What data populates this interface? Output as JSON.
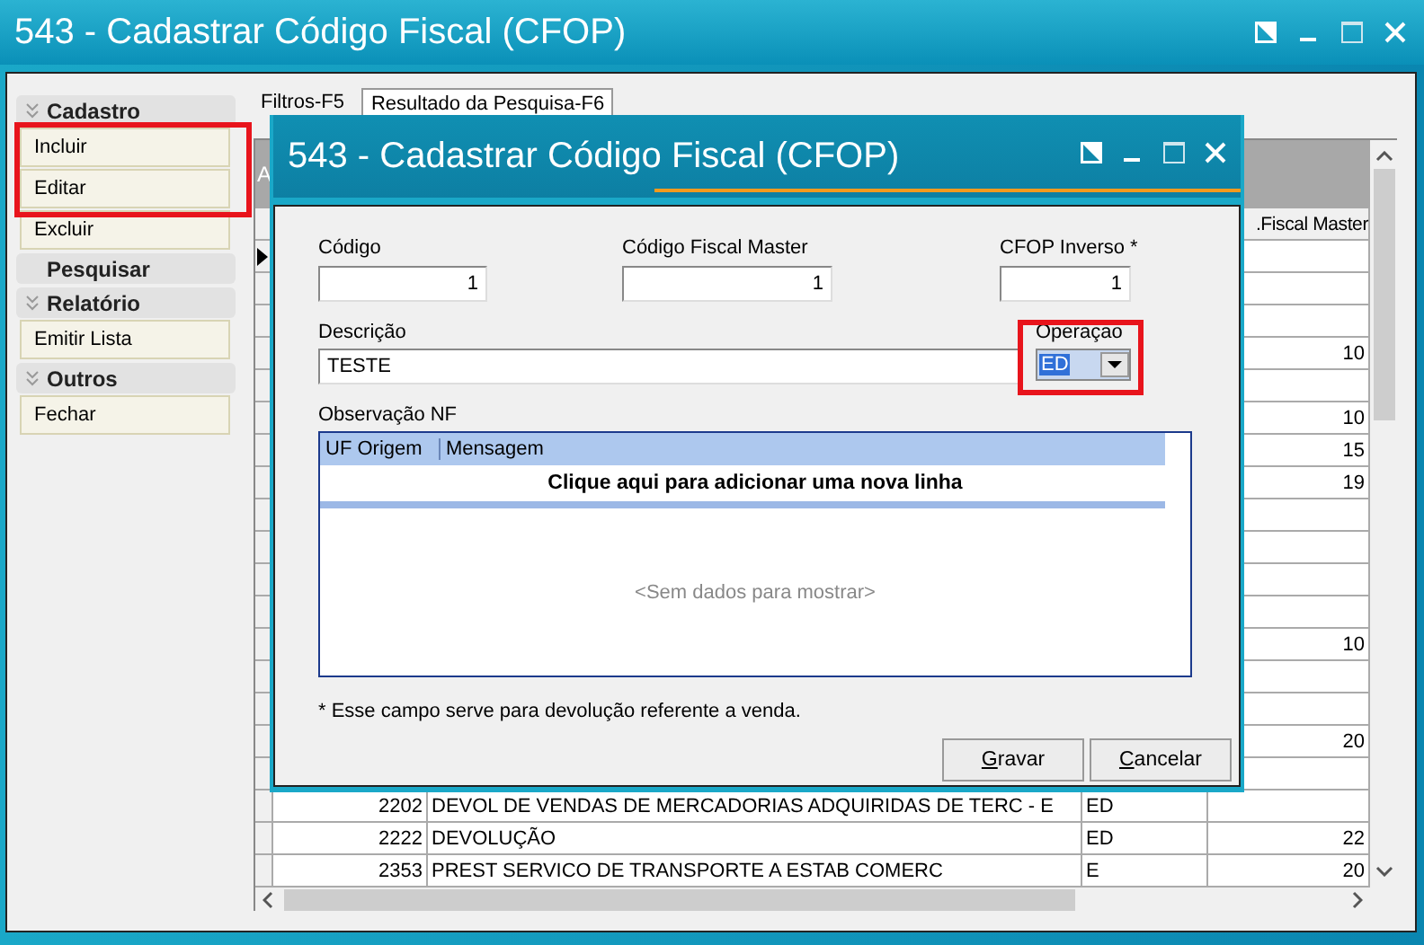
{
  "window": {
    "title": "543 - Cadastrar Código Fiscal (CFOP)"
  },
  "sidebar": {
    "groups": [
      {
        "title": "Cadastro",
        "collapsible": true,
        "items": [
          "Incluir",
          "Editar",
          "Excluir"
        ]
      },
      {
        "title": "Pesquisar",
        "collapsible": false
      },
      {
        "title": "Relatório",
        "collapsible": true,
        "items": [
          "Emitir Lista"
        ]
      },
      {
        "title": "Outros",
        "collapsible": true,
        "items": [
          "Fechar"
        ]
      }
    ]
  },
  "tabs": [
    {
      "label": "Filtros-F5",
      "selected": false
    },
    {
      "label": "Resultado da Pesquisa-F6",
      "selected": true
    }
  ],
  "grid": {
    "group_panel_text": "A",
    "column_4": ".Fiscal Master",
    "rows": [
      {
        "current": true
      },
      {},
      {},
      {
        "column_4": "10"
      },
      {},
      {
        "column_4": "10"
      },
      {
        "column_4": "15"
      },
      {
        "column_4": "19"
      },
      {},
      {},
      {},
      {},
      {
        "column_4": "10"
      },
      {},
      {},
      {
        "column_4": "20"
      },
      {},
      {
        "code": "2202",
        "description": "DEVOL DE VENDAS DE MERCADORIAS ADQUIRIDAS DE TERC - E",
        "operation": "ED"
      },
      {
        "code": "2222",
        "description": "DEVOLUÇÃO",
        "operation": "ED",
        "column_4": "22"
      },
      {
        "code": "2353",
        "description": "PREST  SERVICO DE TRANSPORTE A ESTAB COMERC",
        "operation": "E",
        "column_4": "20"
      }
    ]
  },
  "dialog": {
    "title": "543 - Cadastrar Código Fiscal (CFOP)",
    "fields": [
      {
        "label": "Código",
        "value": "1"
      },
      {
        "label": "Código Fiscal Master",
        "value": "1"
      },
      {
        "label": "CFOP Inverso *",
        "value": "1"
      }
    ],
    "description": {
      "label": "Descrição",
      "value": "TESTE"
    },
    "operation": {
      "label": "Operaçao",
      "value": "ED"
    },
    "observation": {
      "label": "Observação NF",
      "columns": [
        "UF Origem",
        "Mensagem"
      ],
      "new_row_prompt": "Clique aqui para adicionar uma nova linha",
      "empty_text": "<Sem dados para mostrar>"
    },
    "footnote": "* Esse campo serve para devolução referente a venda.",
    "buttons": [
      "Gravar",
      "Cancelar"
    ]
  }
}
